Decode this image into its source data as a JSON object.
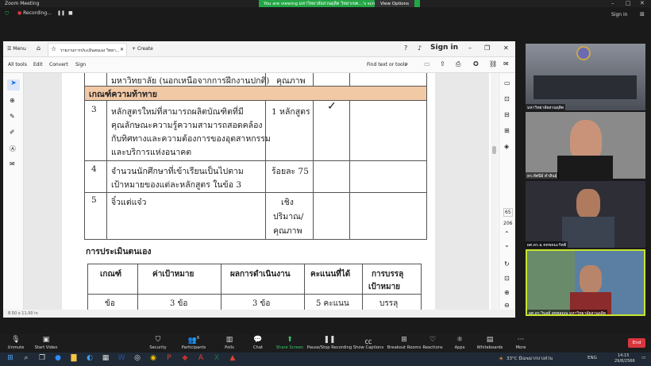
{
  "zoom": {
    "title": "Zoom Meeting",
    "viewing_banner": "You are viewing มหาวิทยาลัยสวนดุสิต วิทยาเขต...'s screen",
    "view_options": "View Options",
    "recording": "Recording...",
    "sign_in": "Sign in",
    "participants_count": "6",
    "toolbar": [
      {
        "icon": "microphone-icon",
        "label": "Unmute"
      },
      {
        "icon": "video-icon",
        "label": "Start Video"
      },
      {
        "icon": "shield-icon",
        "label": "Security"
      },
      {
        "icon": "people-icon",
        "label": "Participants"
      },
      {
        "icon": "chart-icon",
        "label": "Polls"
      },
      {
        "icon": "chat-icon",
        "label": "Chat"
      },
      {
        "icon": "share-icon",
        "label": "Share Screen"
      },
      {
        "icon": "record-icon",
        "label": "Pause/Stop Recording"
      },
      {
        "icon": "cc-icon",
        "label": "Show Captions"
      },
      {
        "icon": "grid-icon",
        "label": "Breakout Rooms"
      },
      {
        "icon": "heart-icon",
        "label": "Reactions"
      },
      {
        "icon": "apps-icon",
        "label": "Apps"
      },
      {
        "icon": "whiteboard-icon",
        "label": "Whiteboards"
      },
      {
        "icon": "more-icon",
        "label": "More"
      }
    ],
    "end": "End",
    "participants": [
      {
        "name": "มหาวิทยาลัยสวนดุสิต"
      },
      {
        "name": "ดร.ทัศนีย์ คำสินธุ์"
      },
      {
        "name": "ผศ.ดร.ฉ คหขคมะรัทพ์"
      },
      {
        "name": "ผศ.ดร.วิบูลย์ สทพลมณ มหาวิทยาลัยสวนดุสิต"
      }
    ]
  },
  "acrobat": {
    "menu": "Menu",
    "tab_title": "รายงานการประเมินตนเอง วิทยา...",
    "create": "Create",
    "sign_in": "Sign in",
    "toolbar": [
      "All tools",
      "Edit",
      "Convert",
      "Sign"
    ],
    "find": "Find text or tools",
    "page_num": "65",
    "page_total": "206",
    "page_size": "8.50 x 11.00 in"
  },
  "document": {
    "row0_text": "มหาวิทยาลัย (นอกเหนือจากการฝึกงานปกติ)",
    "row0_kpi": "คุณภาพ",
    "section_header": "เกณฑ์ความท้าทาย",
    "rows": [
      {
        "num": "3",
        "lines": [
          "หลักสูตรใหม่ที่สามารถผลิตบัณฑิตที่มี",
          "คุณลักษณะความรู้ความสามารถสอดคล้อง",
          "กับทิศทางและความต้องการของอุตสาหกรรม",
          "และบริการแห่งอนาคต"
        ],
        "target": [
          "1 หลักสูตร"
        ],
        "check": "✓"
      },
      {
        "num": "4",
        "lines": [
          "จำนวนนักศึกษาที่เข้าเรียนเป็นไปตาม",
          "เป้าหมายของแต่ละหลักสูตร ในข้อ 3"
        ],
        "target": [
          "ร้อยละ 75"
        ],
        "check": ""
      },
      {
        "num": "5",
        "lines": [
          "จิ๋วแต่แจ๋ว"
        ],
        "target": [
          "เชิง",
          "ปริมาณ/",
          "คุณภาพ"
        ],
        "check": ""
      }
    ],
    "self_eval_title": "การประเมินตนเอง",
    "eval_headers": [
      "เกณฑ์",
      "ค่าเป้าหมาย",
      "ผลการดำเนินงาน",
      "คะแนนที่ได้",
      "การบรรลุ",
      "เป้าหมาย"
    ],
    "eval_values": [
      "ข้อ",
      "3 ข้อ",
      "3 ข้อ",
      "5 คะแนน",
      "บรรลุ"
    ]
  },
  "taskbar": {
    "weather": "33°C มีเมฆมากบางส่วน",
    "lang": "ENG",
    "time": "14:15",
    "date": "29/8/2566"
  },
  "colors": {
    "section_bg": "#f2c9a5",
    "banner_green": "#23a645",
    "end_red": "#d9363e"
  }
}
